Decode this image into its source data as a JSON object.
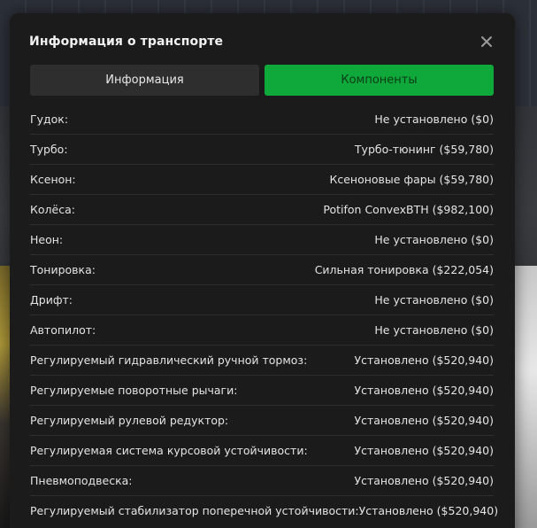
{
  "modal": {
    "title": "Информация о транспорте"
  },
  "tabs": [
    {
      "label": "Информация",
      "active": false
    },
    {
      "label": "Компоненты",
      "active": true
    }
  ],
  "colors": {
    "accent": "#0fa83a",
    "panel": "#1b1b1b",
    "tab_inactive": "#2e2e2e"
  },
  "icons": {
    "close": "close-icon"
  },
  "components": [
    {
      "label": "Гудок:",
      "value": "Не установлено ($0)"
    },
    {
      "label": "Турбо:",
      "value": "Турбо-тюнинг ($59,780)"
    },
    {
      "label": "Ксенон:",
      "value": "Ксеноновые фары ($59,780)"
    },
    {
      "label": "Колёса:",
      "value": "Potifon ConvexBTH ($982,100)"
    },
    {
      "label": "Неон:",
      "value": "Не установлено ($0)"
    },
    {
      "label": "Тонировка:",
      "value": "Сильная тонировка ($222,054)"
    },
    {
      "label": "Дрифт:",
      "value": "Не установлено ($0)"
    },
    {
      "label": "Автопилот:",
      "value": "Не установлено ($0)"
    },
    {
      "label": "Регулируемый гидравлический ручной тормоз:",
      "value": "Установлено ($520,940)"
    },
    {
      "label": "Регулируемые поворотные рычаги:",
      "value": "Установлено ($520,940)"
    },
    {
      "label": "Регулируемый рулевой редуктор:",
      "value": "Установлено ($520,940)"
    },
    {
      "label": "Регулируемая система курсовой устойчивости:",
      "value": "Установлено ($520,940)"
    },
    {
      "label": "Пневмоподвеска:",
      "value": "Установлено ($520,940)"
    },
    {
      "label": "Регулируемый стабилизатор поперечной устойчивости:",
      "value": "Установлено ($520,940)"
    }
  ]
}
